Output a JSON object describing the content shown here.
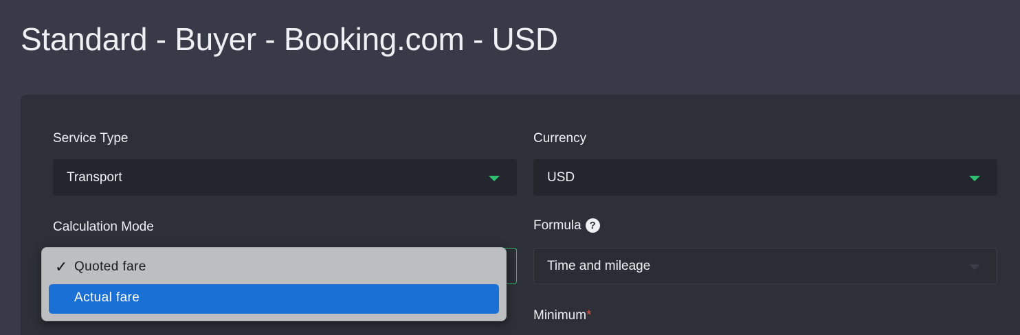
{
  "page": {
    "title": "Standard - Buyer - Booking.com - USD"
  },
  "form": {
    "service_type": {
      "label": "Service Type",
      "value": "Transport"
    },
    "currency": {
      "label": "Currency",
      "value": "USD"
    },
    "calculation_mode": {
      "label": "Calculation Mode",
      "options": [
        {
          "label": "Quoted fare",
          "selected": true,
          "check": "✓"
        },
        {
          "label": "Actual fare",
          "selected": false,
          "highlighted": true
        }
      ]
    },
    "formula": {
      "label": "Formula",
      "help_icon": "?",
      "value": "Time and mileage"
    },
    "minimum": {
      "label": "Minimum",
      "required_mark": "*"
    }
  },
  "colors": {
    "accent": "#2fbf71",
    "highlight": "#1b70d6",
    "required": "#e0574a",
    "background": "#383b47",
    "card": "#2e3039"
  }
}
